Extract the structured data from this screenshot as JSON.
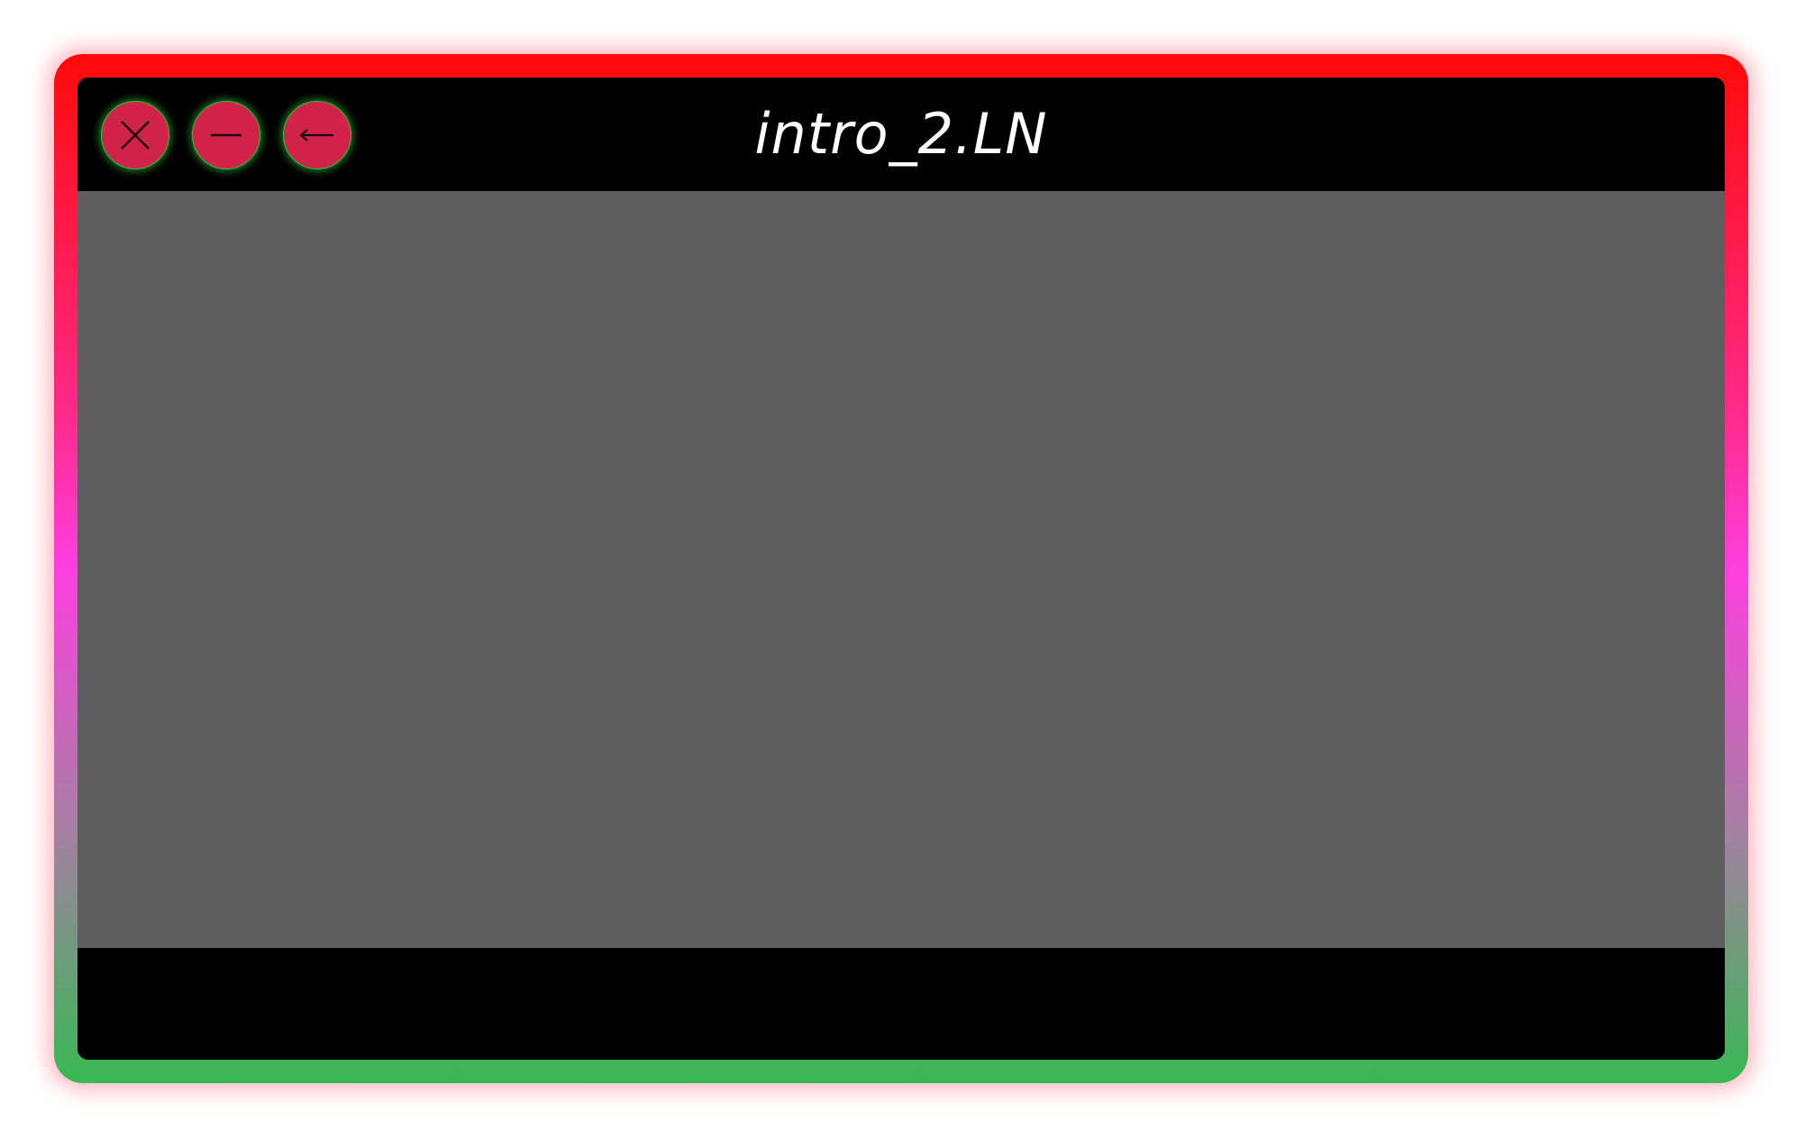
{
  "window": {
    "title": "intro_2.LN",
    "controls": [
      {
        "name": "close-button",
        "icon": "close-icon"
      },
      {
        "name": "minimize-button",
        "icon": "minus-icon"
      },
      {
        "name": "back-button",
        "icon": "arrow-left-icon"
      }
    ]
  },
  "colors": {
    "frame_gradient": [
      "#ff0a0a",
      "#ff2a8a",
      "#ff3fe0",
      "#a77fa4",
      "#37b853"
    ],
    "titlebar": "#000000",
    "content": "#5e5e5e",
    "control_fill": "#d1224a",
    "control_glow": "#2fbf3f",
    "title_text": "#ffffff"
  }
}
